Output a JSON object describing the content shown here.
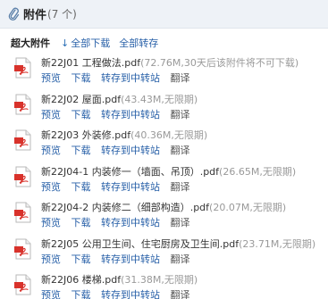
{
  "header": {
    "title": "附件",
    "count": "(7 个)"
  },
  "toolbar": {
    "big_label": "超大附件",
    "download_all": "全部下载",
    "save_all": "全部转存"
  },
  "actions": {
    "preview": "预览",
    "download": "下载",
    "transfer": "转存到中转站",
    "translate": "翻译"
  },
  "attachments": [
    {
      "name": "新22J01 工程做法.pdf",
      "meta": "(72.76M,30天后该附件将不可下载)"
    },
    {
      "name": "新22J02 屋面.pdf",
      "meta": "(43.43M,无限期)"
    },
    {
      "name": "新22J03 外装修.pdf",
      "meta": "(40.36M,无限期)"
    },
    {
      "name": "新22J04-1 内装修一（墙面、吊顶）.pdf",
      "meta": "(26.65M,无限期)"
    },
    {
      "name": "新22J04-2 内装修二（细部构造）.pdf",
      "meta": "(20.07M,无限期)"
    },
    {
      "name": "新22J05 公用卫生间、住宅厨房及卫生间.pdf",
      "meta": "(23.71M,无限期)"
    },
    {
      "name": "新22J06 楼梯.pdf",
      "meta": "(31.38M,无限期)"
    }
  ],
  "icons": {
    "header": "paperclip-icon",
    "download": "download-arrow-icon",
    "file": "pdf-file-icon"
  }
}
